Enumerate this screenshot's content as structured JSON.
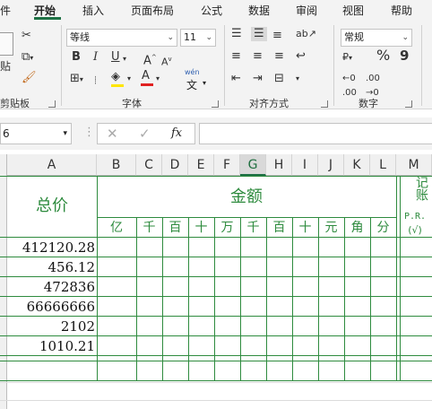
{
  "ribbon": {
    "tabs": [
      "件",
      "开始",
      "插入",
      "页面布局",
      "公式",
      "数据",
      "审阅",
      "视图",
      "帮助"
    ],
    "active_tab": "开始",
    "clipboard": {
      "paste_label": "贴",
      "group_label": "剪贴板"
    },
    "font": {
      "name": "等线",
      "size": "11",
      "bold": "B",
      "italic": "I",
      "underline": "U",
      "grow": "A",
      "shrink": "A",
      "wen": "wén",
      "wen_char": "文",
      "font_color_letter": "A",
      "group_label": "字体"
    },
    "alignment": {
      "group_label": "对齐方式"
    },
    "number": {
      "format": "常规",
      "percent": "%",
      "comma": "9",
      "group_label": "数字"
    }
  },
  "formula_bar": {
    "name_box": "6",
    "fx": "fx"
  },
  "columns": [
    "A",
    "B",
    "C",
    "D",
    "E",
    "F",
    "G",
    "H",
    "I",
    "J",
    "K",
    "L",
    "M"
  ],
  "selected_column": "G",
  "table": {
    "total_header": "总价",
    "amount_header": "金额",
    "units": [
      "亿",
      "千",
      "百",
      "十",
      "万",
      "千",
      "百",
      "十",
      "元",
      "角",
      "分"
    ],
    "posting_header": "记账",
    "posting_sub": "P.R.",
    "posting_mark": "(√)",
    "totals": [
      "412120.28",
      "456.12",
      "472836",
      "66666666",
      "2102",
      "1010.21"
    ]
  },
  "colors": {
    "accent": "#2e8b3e",
    "ribbon_bg": "#f3f3f3",
    "font_color_bar": "#e02020",
    "fill_color_bar": "#ffe600"
  }
}
